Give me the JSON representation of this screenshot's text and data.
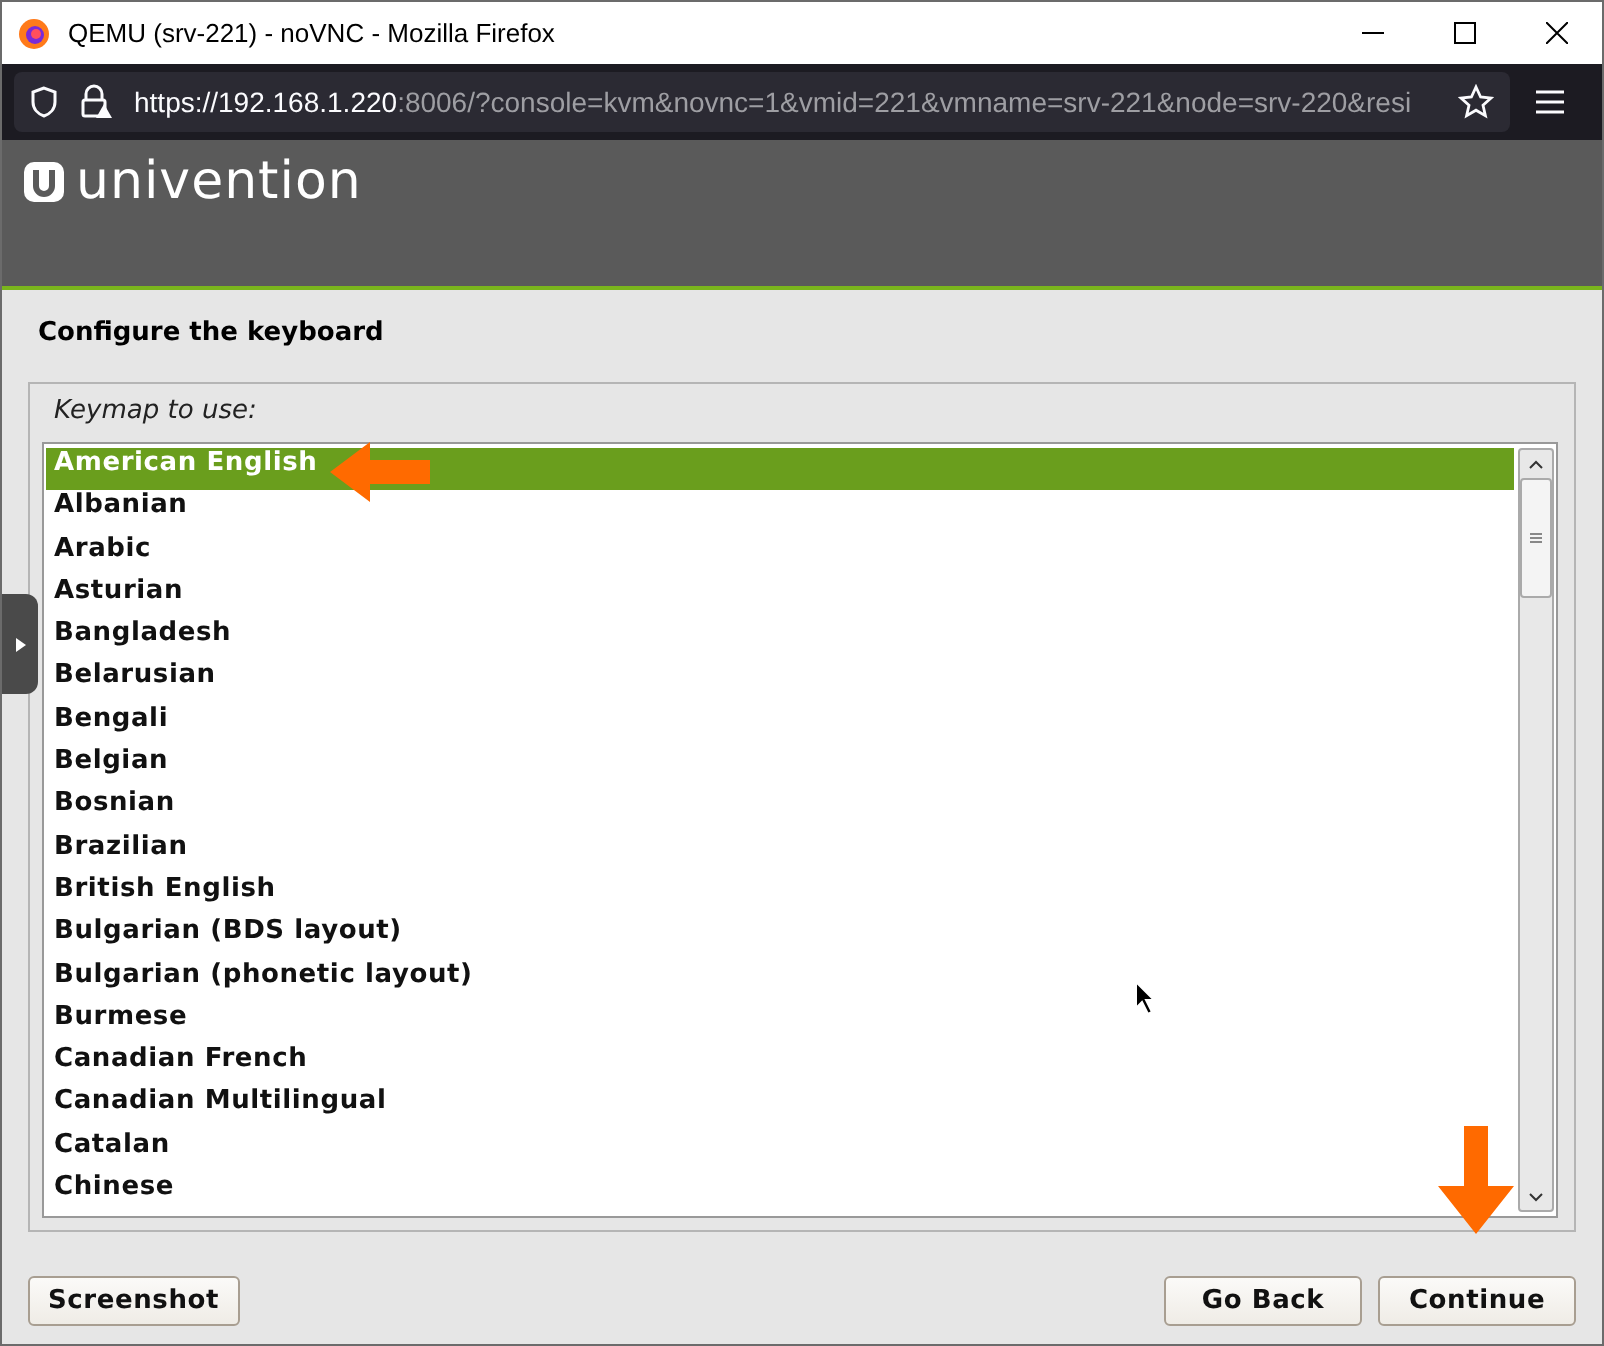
{
  "window": {
    "title": "QEMU (srv-221) - noVNC - Mozilla Firefox"
  },
  "address_bar": {
    "url_host": "https://192.168.1.220",
    "url_rest": ":8006/?console=kvm&novnc=1&vmid=221&vmname=srv-221&node=srv-220&resi"
  },
  "brand": {
    "name": "univention"
  },
  "installer": {
    "title": "Configure the keyboard",
    "list_label": "Keymap to use:",
    "keymaps": [
      {
        "label": "American English",
        "selected": true
      },
      {
        "label": "Albanian",
        "selected": false
      },
      {
        "label": "Arabic",
        "selected": false
      },
      {
        "label": "Asturian",
        "selected": false
      },
      {
        "label": "Bangladesh",
        "selected": false
      },
      {
        "label": "Belarusian",
        "selected": false
      },
      {
        "label": "Bengali",
        "selected": false
      },
      {
        "label": "Belgian",
        "selected": false
      },
      {
        "label": "Bosnian",
        "selected": false
      },
      {
        "label": "Brazilian",
        "selected": false
      },
      {
        "label": "British English",
        "selected": false
      },
      {
        "label": "Bulgarian (BDS layout)",
        "selected": false
      },
      {
        "label": "Bulgarian (phonetic layout)",
        "selected": false
      },
      {
        "label": "Burmese",
        "selected": false
      },
      {
        "label": "Canadian French",
        "selected": false
      },
      {
        "label": "Canadian Multilingual",
        "selected": false
      },
      {
        "label": "Catalan",
        "selected": false
      },
      {
        "label": "Chinese",
        "selected": false
      }
    ],
    "buttons": [
      {
        "label": "Screenshot",
        "kind": "left"
      },
      {
        "label": "Go Back",
        "kind": "right"
      },
      {
        "label": "Continue",
        "kind": "right"
      }
    ]
  }
}
